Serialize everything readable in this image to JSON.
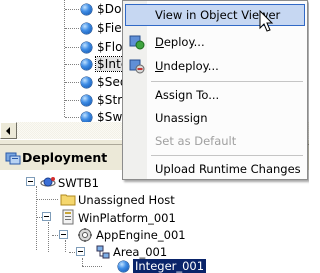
{
  "upper_tree": {
    "items": [
      {
        "label": "$Dou",
        "selected": false
      },
      {
        "label": "$Fiel",
        "selected": false
      },
      {
        "label": "$Floa",
        "selected": false
      },
      {
        "label": "$Inte",
        "selected": true
      },
      {
        "label": "$Seq",
        "selected": false
      },
      {
        "label": "$Strin",
        "selected": false
      },
      {
        "label": "$Swit",
        "selected": false
      }
    ]
  },
  "deployment": {
    "title": "Deployment",
    "tree": {
      "galaxy": "SWTB1",
      "unassigned_host": "Unassigned Host",
      "platform": "WinPlatform_001",
      "engine": "AppEngine_001",
      "area": "Area_001",
      "object": "Integer_001"
    }
  },
  "context_menu": {
    "view_in_object_viewer": "View in Object Viewer",
    "deploy": "Deploy...",
    "undeploy": "Undeploy...",
    "assign_to": "Assign To...",
    "unassign": "Unassign",
    "set_as_default": "Set as Default",
    "upload_runtime_changes": "Upload Runtime Changes"
  },
  "colors": {
    "highlight_bg": "#c6d7f2",
    "highlight_border": "#3169c6",
    "tree_selection": "#0a246a",
    "panel_bg": "#ece9d8"
  }
}
